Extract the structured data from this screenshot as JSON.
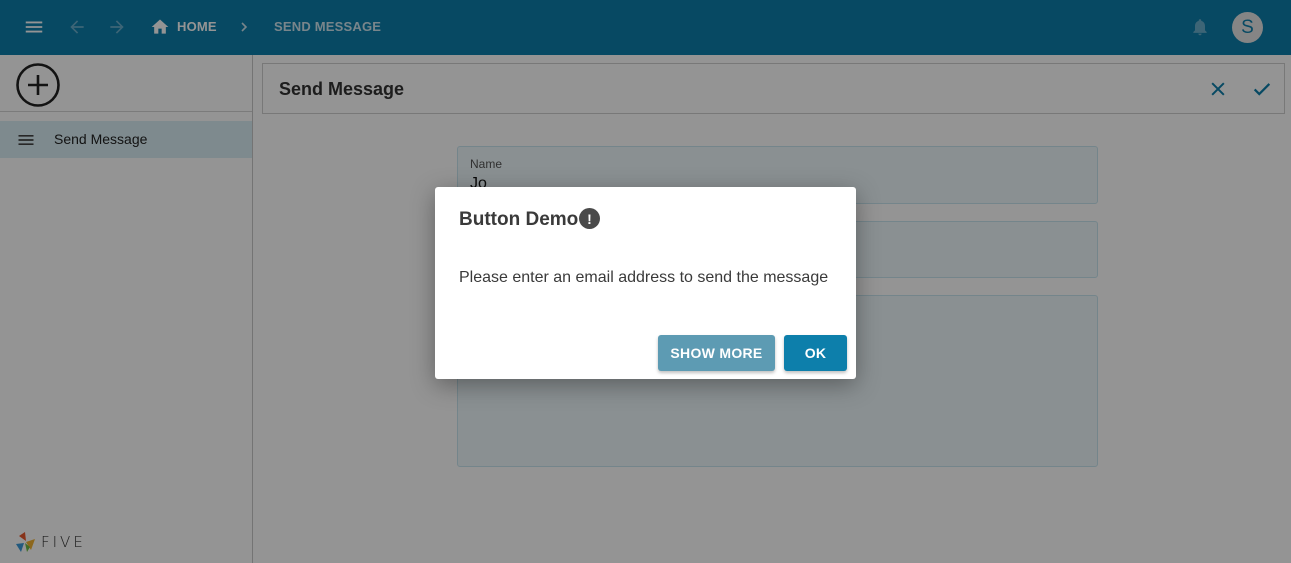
{
  "appbar": {
    "icons": [
      "menu-icon",
      "arrow-back-icon",
      "arrow-forward-icon",
      "home-icon",
      "chevron-right-icon",
      "bell-icon"
    ],
    "breadcrumb": {
      "home": "HOME",
      "current": "SEND MESSAGE"
    },
    "avatar_initial": "S",
    "color": "#0d7fab"
  },
  "sidebar": {
    "add_icon": "add-circle-icon",
    "items": [
      {
        "label": "Send Message",
        "icon": "menu-icon"
      }
    ],
    "logo_text": "FIVE"
  },
  "form": {
    "title": "Send Message",
    "actions": [
      "close-icon",
      "check-icon"
    ],
    "fields": [
      {
        "label": "Name",
        "value": "Jo"
      },
      {
        "label": "",
        "value": ""
      },
      {
        "label": "",
        "value": ""
      }
    ]
  },
  "dialog": {
    "title": "Button Demo",
    "title_icon": "exclamation-icon",
    "message": "Please enter an email address to send the message",
    "buttons": {
      "show_more": "SHOW MORE",
      "ok": "OK"
    }
  }
}
